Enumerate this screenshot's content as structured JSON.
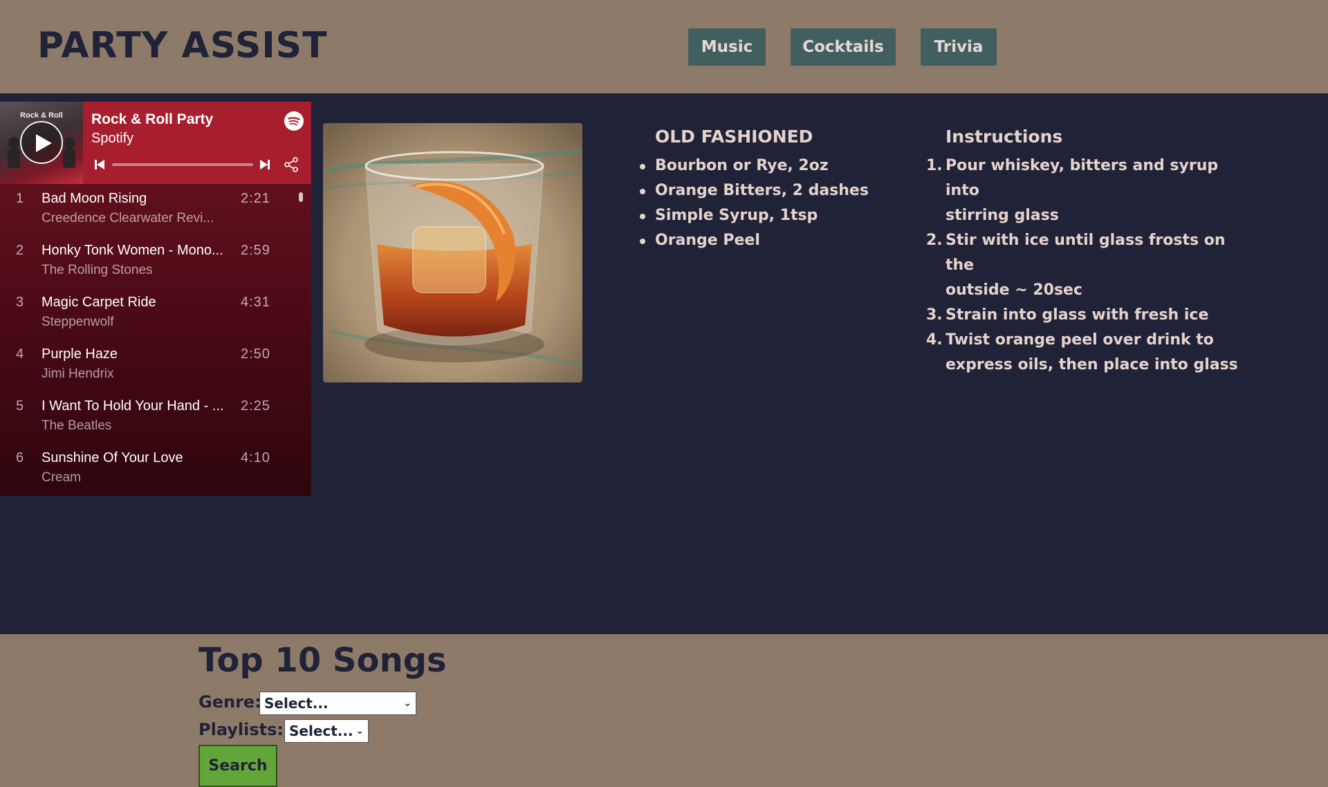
{
  "app": {
    "title": "PARTY ASSIST"
  },
  "nav": [
    {
      "label": "Music"
    },
    {
      "label": "Cocktails"
    },
    {
      "label": "Trivia"
    }
  ],
  "player": {
    "cover_text": "Rock & Roll",
    "playlist_title": "Rock & Roll Party",
    "provider": "Spotify",
    "icons": {
      "play": "play-icon",
      "logo": "spotify-logo-icon",
      "prev": "skip-previous-icon",
      "next": "skip-next-icon",
      "share": "share-icon"
    },
    "progress": 0,
    "tracks": [
      {
        "num": "1",
        "name": "Bad Moon Rising",
        "artist": "Creedence Clearwater Revi...",
        "duration": "2:21"
      },
      {
        "num": "2",
        "name": "Honky Tonk Women - Mono...",
        "artist": "The Rolling Stones",
        "duration": "2:59"
      },
      {
        "num": "3",
        "name": "Magic Carpet Ride",
        "artist": "Steppenwolf",
        "duration": "4:31"
      },
      {
        "num": "4",
        "name": "Purple Haze",
        "artist": "Jimi Hendrix",
        "duration": "2:50"
      },
      {
        "num": "5",
        "name": "I Want To Hold Your Hand - ...",
        "artist": "The Beatles",
        "duration": "2:25"
      },
      {
        "num": "6",
        "name": "Sunshine Of Your Love",
        "artist": "Cream",
        "duration": "4:10"
      }
    ]
  },
  "recipe": {
    "name": "OLD FASHIONED",
    "ingredients": [
      "Bourbon or Rye, 2oz",
      "Orange Bitters, 2 dashes",
      "Simple Syrup, 1tsp",
      "Orange Peel"
    ],
    "instructions_title": "Instructions",
    "instructions": [
      {
        "n": "1.",
        "lines": [
          "Pour whiskey, bitters and syrup into",
          "stirring glass"
        ]
      },
      {
        "n": "2.",
        "lines": [
          "Stir with ice until glass frosts on the",
          "outside ~ 20sec"
        ]
      },
      {
        "n": "3.",
        "lines": [
          "Strain into glass with fresh ice"
        ]
      },
      {
        "n": "4.",
        "lines": [
          "Twist orange peel over drink to",
          "express oils, then place into glass"
        ]
      }
    ]
  },
  "top_songs": {
    "title": "Top 10 Songs",
    "genre_label": "Genre:",
    "genre_value": "Select...",
    "playlists_label": "Playlists:",
    "playlists_value": "Select...",
    "search_label": "Search"
  },
  "colors": {
    "header_bg": "#8d7a69",
    "page_bg": "#202338",
    "nav_button": "#425f60",
    "player_red": "#a71f2f",
    "recipe_text": "#e6d3cc",
    "search_green": "#62a538"
  }
}
